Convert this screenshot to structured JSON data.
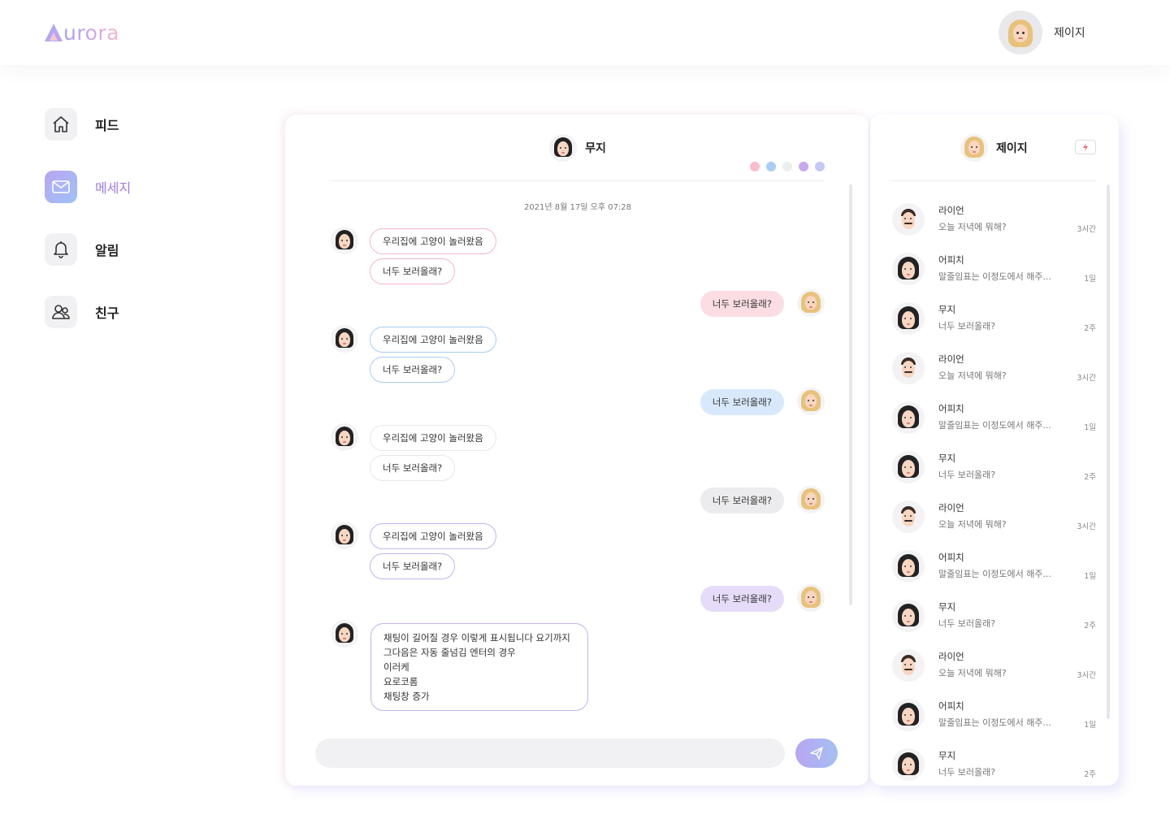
{
  "app": {
    "logo_first": "A",
    "logo_rest": "urora"
  },
  "user": {
    "name": "제이지"
  },
  "colors": {
    "accent": "#a27be6",
    "pink": "#f6b8c6",
    "blue": "#a9d0f5",
    "purple": "#cdb6f2"
  },
  "nav": [
    {
      "label": "피드",
      "icon": "home-icon",
      "active": false
    },
    {
      "label": "메세지",
      "icon": "mail-icon",
      "active": true
    },
    {
      "label": "알림",
      "icon": "bell-icon",
      "active": false
    },
    {
      "label": "친구",
      "icon": "friends-icon",
      "active": false
    }
  ],
  "chat": {
    "title": "무지",
    "theme_dots": [
      "#f8bccb",
      "#a8cdf4",
      "#eeeeee",
      "#c8a8ef",
      "#c5c8f5"
    ],
    "date": "2021년 8월 17일 오후 07:28",
    "groups": [
      {
        "in1": "우리집에 고양이 놀러왔음",
        "in2": "너두 보러올래?",
        "out": "너두 보러올래?"
      },
      {
        "in1": "우리집에 고양이 놀러왔음",
        "in2": "너두 보러올래?",
        "out": "너두 보러올래?"
      },
      {
        "in1": "우리집에 고양이 놀러왔음",
        "in2": "너두 보러올래?",
        "out": "너두 보러올래?"
      },
      {
        "in1": "우리집에 고양이 놀러왔음",
        "in2": "너두 보러올래?",
        "out": "너두 보러올래?"
      }
    ],
    "long_message": [
      "채팅이 길어질 경우 이렇게 표시됩니다 요기까지",
      "그다음은 자동 줄넘김 엔터의 경우",
      "이러케",
      "요로코롬",
      "채팅창 증가"
    ],
    "composer_placeholder": ""
  },
  "friends": {
    "title": "제이지",
    "items": [
      {
        "name": "라이언",
        "msg": "오늘 저녁에 뭐해?",
        "time": "3시간",
        "avatar": "man"
      },
      {
        "name": "어피치",
        "msg": "말줄임표는 이정도에서 해주...",
        "time": "1일",
        "avatar": "woman"
      },
      {
        "name": "무지",
        "msg": "너두 보러올래?",
        "time": "2주",
        "avatar": "woman"
      },
      {
        "name": "라이언",
        "msg": "오늘 저녁에 뭐해?",
        "time": "3시간",
        "avatar": "man"
      },
      {
        "name": "어피치",
        "msg": "말줄임표는 이정도에서 해주...",
        "time": "1일",
        "avatar": "woman"
      },
      {
        "name": "무지",
        "msg": "너두 보러올래?",
        "time": "2주",
        "avatar": "woman"
      },
      {
        "name": "라이언",
        "msg": "오늘 저녁에 뭐해?",
        "time": "3시간",
        "avatar": "man"
      },
      {
        "name": "어피치",
        "msg": "말줄임표는 이정도에서 해주...",
        "time": "1일",
        "avatar": "woman"
      },
      {
        "name": "무지",
        "msg": "너두 보러올래?",
        "time": "2주",
        "avatar": "woman"
      },
      {
        "name": "라이언",
        "msg": "오늘 저녁에 뭐해?",
        "time": "3시간",
        "avatar": "man"
      },
      {
        "name": "어피치",
        "msg": "말줄임표는 이정도에서 해주...",
        "time": "1일",
        "avatar": "woman"
      },
      {
        "name": "무지",
        "msg": "너두 보러올래?",
        "time": "2주",
        "avatar": "woman"
      }
    ]
  }
}
